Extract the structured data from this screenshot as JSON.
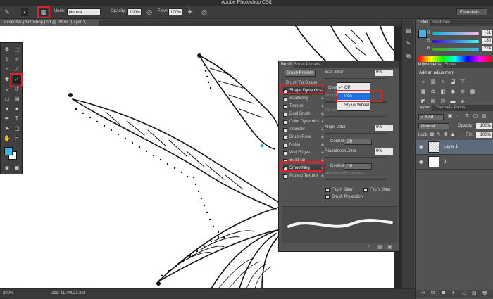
{
  "window": {
    "title": "Adobe Photoshop CS6"
  },
  "options_bar": {
    "mode_label": "Mode:",
    "mode_value": "Normal",
    "opacity_label": "Opacity:",
    "opacity_value": "100%",
    "flow_label": "Flow:",
    "flow_value": "100%",
    "workspace": "Essentials",
    "icons": [
      "brush-preset-icon",
      "brush-panel-toggle-icon",
      "pressure-opacity-icon",
      "airbrush-icon",
      "pressure-size-icon"
    ]
  },
  "document": {
    "tab_label": "desenhar-photoshop.psd @ 200% (Layer 1, RGB/8) *",
    "zoom": "200%"
  },
  "status_bar": {
    "zoom": "200%",
    "doc_info": "Doc: 11.4M/21.8M"
  },
  "brush_panel": {
    "tabs": [
      "Brush",
      "Brush Presets"
    ],
    "presets_button": "Brush Presets",
    "options": [
      {
        "label": "Brush Tip Shape",
        "checked": null
      },
      {
        "label": "Shape Dynamics",
        "checked": true
      },
      {
        "label": "Scattering",
        "checked": false
      },
      {
        "label": "Texture",
        "checked": false
      },
      {
        "label": "Dual Brush",
        "checked": false
      },
      {
        "label": "Color Dynamics",
        "checked": false
      },
      {
        "label": "Transfer",
        "checked": false
      },
      {
        "label": "Brush Pose",
        "checked": false
      },
      {
        "label": "Noise",
        "checked": false
      },
      {
        "label": "Wet Edges",
        "checked": false
      },
      {
        "label": "Build-up",
        "checked": false
      },
      {
        "label": "Smoothing",
        "checked": true
      },
      {
        "label": "Protect Texture",
        "checked": false
      }
    ],
    "size_jitter_label": "Size Jitter",
    "size_jitter_value": "0%",
    "control_label": "Control:",
    "minimum_diameter_label": "Minimum Diameter",
    "tilt_scale_label": "Tilt Scale",
    "angle_jitter_label": "Angle Jitter",
    "angle_jitter_value": "0%",
    "angle_control_value": "Off",
    "roundness_jitter_label": "Roundness Jitter",
    "roundness_jitter_value": "0%",
    "roundness_control_value": "Off",
    "minimum_roundness_label": "Minimum Roundness",
    "flip_x_label": "Flip X Jitter",
    "flip_y_label": "Flip Y Jitter",
    "brush_projection_label": "Brush Projection"
  },
  "control_popup": {
    "items": [
      "Off",
      "Pen Pressure",
      "Stylus Wheel"
    ],
    "checked_index": 0,
    "highlighted_index": 1
  },
  "color_panel": {
    "tabs": [
      "Color",
      "Swatches"
    ],
    "r": "61",
    "g": "180",
    "b": "224",
    "r_label": "R",
    "g_label": "G",
    "b_label": "B"
  },
  "adjustments_panel": {
    "tabs": [
      "Adjustments",
      "Styles"
    ],
    "heading": "Add an adjustment"
  },
  "layers_panel": {
    "tabs": [
      "Layers",
      "Channels",
      "Paths"
    ],
    "filter_kind": "Kind",
    "blend_mode": "Normal",
    "opacity_label": "Opacity:",
    "opacity_value": "100%",
    "lock_label": "Lock:",
    "fill_label": "Fill:",
    "fill_value": "100%",
    "layers": [
      {
        "name": "Layer 1",
        "selected": true
      },
      {
        "name": "d",
        "selected": false
      }
    ]
  },
  "colors": {
    "foreground": "#3db4e0",
    "background": "#ffffff",
    "highlight": "#e0202a",
    "menu_highlight": "#1a72e3"
  }
}
